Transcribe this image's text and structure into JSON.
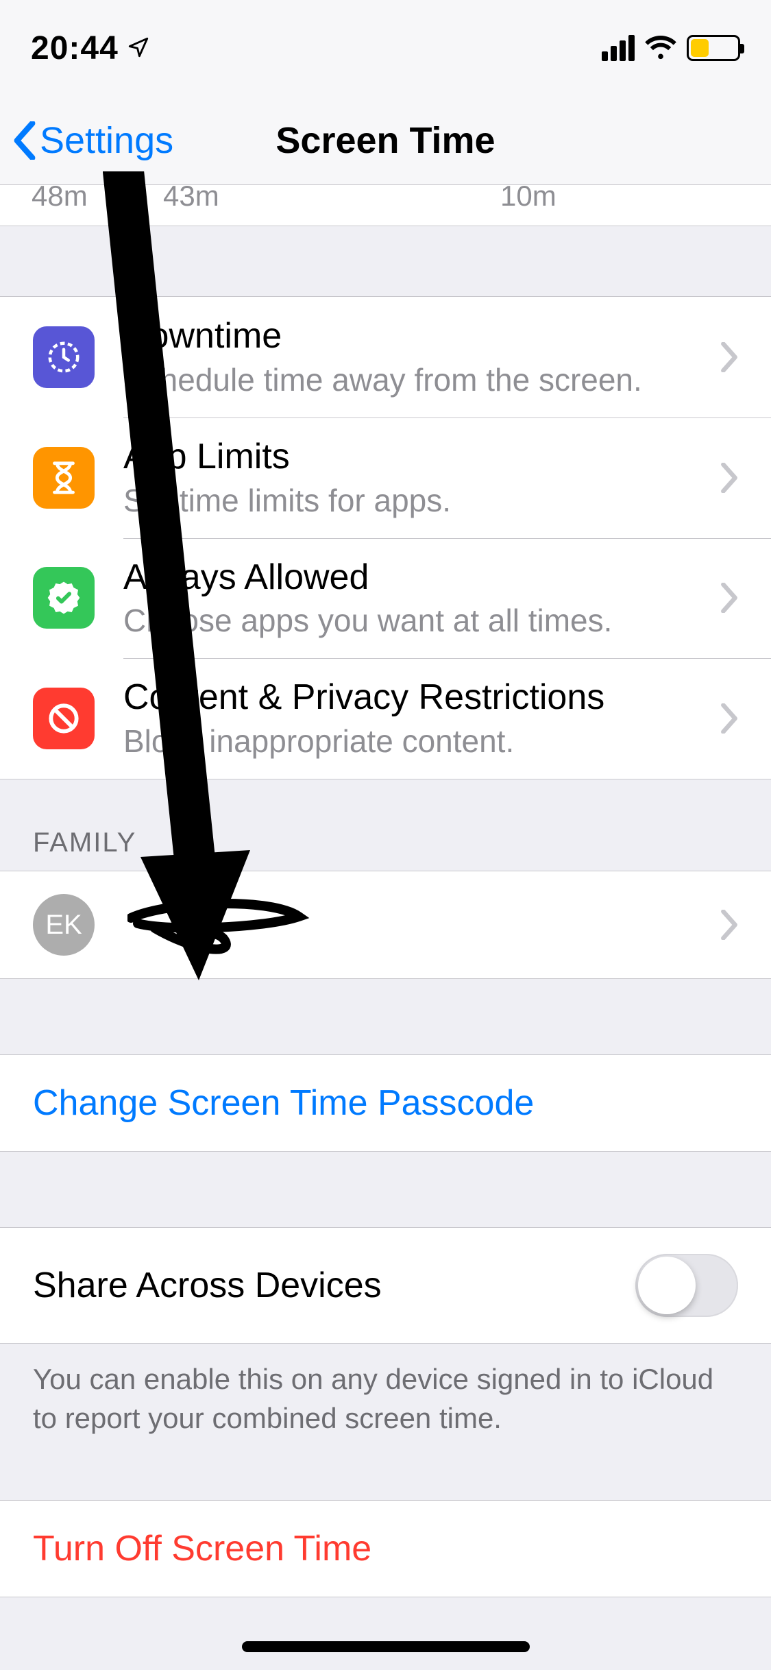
{
  "status": {
    "time": "20:44"
  },
  "nav": {
    "back_label": "Settings",
    "title": "Screen Time"
  },
  "usage_clip": {
    "v1": "48m",
    "v2": "43m",
    "v3": "10m"
  },
  "items": [
    {
      "title": "Downtime",
      "subtitle": "Schedule time away from the screen."
    },
    {
      "title": "App Limits",
      "subtitle": "Set time limits for apps."
    },
    {
      "title": "Always Allowed",
      "subtitle": "Choose apps you want at all times."
    },
    {
      "title": "Content & Privacy Restrictions",
      "subtitle": "Block inappropriate content."
    }
  ],
  "family": {
    "header": "FAMILY",
    "initials": "EK",
    "name_redacted": ""
  },
  "change_passcode": "Change Screen Time Passcode",
  "share": {
    "label": "Share Across Devices",
    "enabled": false,
    "footer": "You can enable this on any device signed in to iCloud to report your combined screen time."
  },
  "turn_off": "Turn Off Screen Time",
  "colors": {
    "tint": "#007aff",
    "danger": "#ff3b30"
  }
}
